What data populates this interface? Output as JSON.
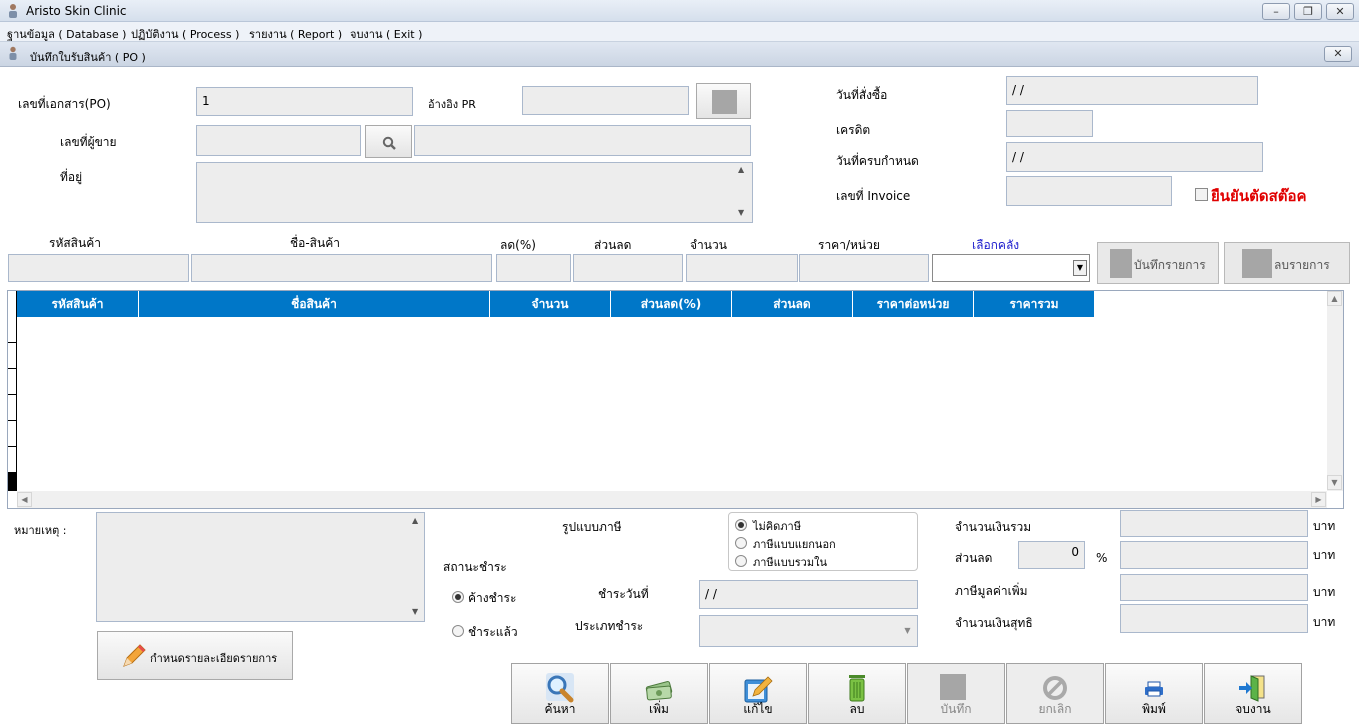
{
  "window": {
    "title": "Aristo Skin Clinic"
  },
  "menu": [
    "ฐานข้อมูล ( Database )",
    "ปฏิบัติงาน ( Process )",
    "รายงาน ( Report )",
    "จบงาน ( Exit )"
  ],
  "child_window": {
    "title": "บันทึกใบรับสินค้า ( PO )"
  },
  "header": {
    "po_label": "เลขที่เอกสาร(PO)",
    "po_value": "1",
    "pr_label": "อ้างอิง PR",
    "pr_value": "",
    "vendor_label": "เลขที่ผู้ขาย",
    "vendor_code": "",
    "vendor_name": "",
    "address_label": "ที่อยู่",
    "address_value": "",
    "order_date_label": "วันที่สั่งซื้อ",
    "order_date_value": " / /",
    "credit_label": "เครดิต",
    "credit_value": "",
    "due_date_label": "วันที่ครบกำหนด",
    "due_date_value": " / /",
    "invoice_label": "เลขที่ Invoice",
    "invoice_value": "",
    "confirm_stock_label": "ยืนยันตัดสต๊อค"
  },
  "entry": {
    "code_label": "รหัสสินค้า",
    "name_label": "ชื่อ-สินค้า",
    "discount_pct_label": "ลด(%)",
    "discount_label": "ส่วนลด",
    "qty_label": "จำนวน",
    "unit_price_label": "ราคา/หน่วย",
    "warehouse_label": "เลือกคลัง",
    "warehouse_value": "",
    "save_item_label": "บันทึกรายการ",
    "delete_item_label": "ลบรายการ"
  },
  "grid": {
    "columns": [
      "รหัสสินค้า",
      "ชื่อสินค้า",
      "จำนวน",
      "ส่วนลด(%)",
      "ส่วนลด",
      "ราคาต่อหน่วย",
      "ราคารวม"
    ],
    "rows": []
  },
  "footer": {
    "remark_label": "หมายเหตุ :",
    "remark_value": "",
    "detail_button_label": "กำหนดรายละเอียดรายการ",
    "tax_type_label": "รูปแบบภาษี",
    "tax_options": [
      "ไม่คิดภาษี",
      "ภาษีแบบแยกนอก",
      "ภาษีแบบรวมใน"
    ],
    "tax_selected": 0,
    "payment_status_label": "สถานะชำระ",
    "payment_status_options": [
      "ค้างชำระ",
      "ชำระแล้ว"
    ],
    "payment_status_selected": 0,
    "payment_date_label": "ชำระวันที่",
    "payment_date_value": " / /",
    "payment_type_label": "ประเภทชำระ",
    "payment_type_value": "",
    "total_label": "จำนวนเงินรวม",
    "total_value": "",
    "discount_label": "ส่วนลด",
    "discount_pct_value": "0",
    "percent_sign": "%",
    "discount_value": "",
    "vat_label": "ภาษีมูลค่าเพิ่ม",
    "vat_value": "",
    "net_label": "จำนวนเงินสุทธิ",
    "net_value": "",
    "currency_unit": "บาท"
  },
  "toolbar": {
    "search": "ค้นหา",
    "add": "เพิ่ม",
    "edit": "แก้ไข",
    "delete": "ลบ",
    "save": "บันทึก",
    "cancel": "ยกเลิก",
    "print": "พิมพ์",
    "exit": "จบงาน"
  },
  "colors": {
    "grid_header": "#0077c8",
    "confirm_text": "#e00000",
    "warehouse_label": "#1a1acc"
  },
  "icons": {
    "search": "magnifier-icon",
    "add": "money-icon",
    "edit": "edit-pencil-icon",
    "delete": "trash-icon",
    "save": "gray-square-icon",
    "cancel": "no-entry-icon",
    "print": "printer-icon",
    "exit": "exit-door-icon"
  }
}
